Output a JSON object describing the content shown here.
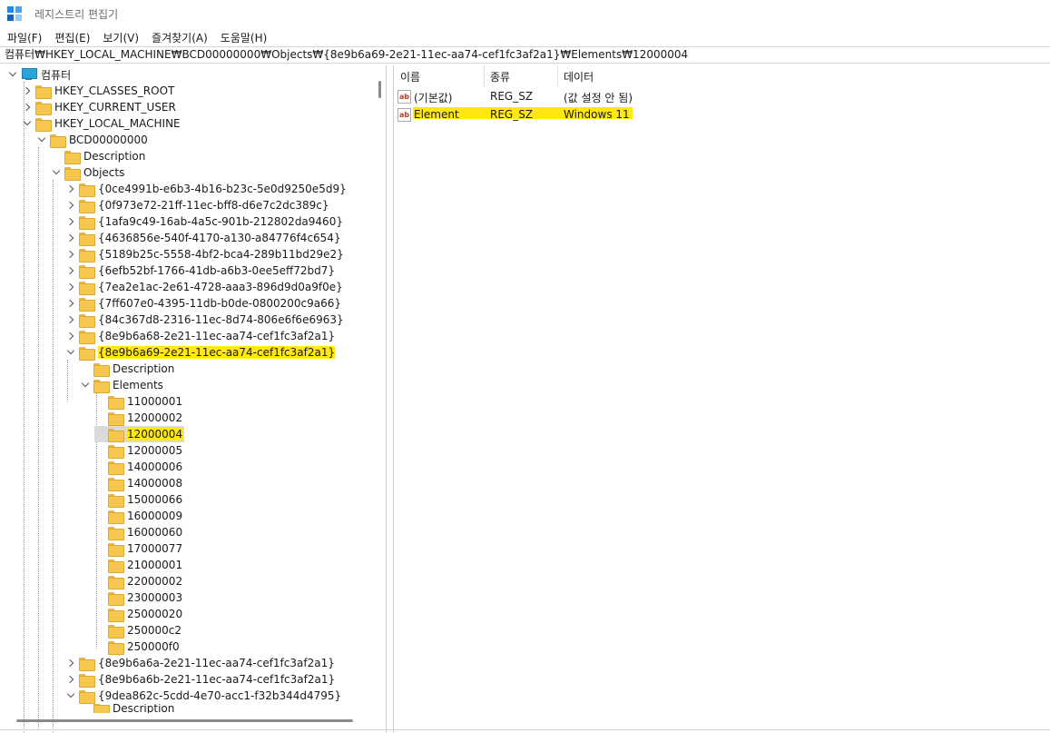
{
  "window": {
    "title": "레지스트리 편집기"
  },
  "menu": [
    "파일(F)",
    "편집(E)",
    "보기(V)",
    "즐겨찾기(A)",
    "도움말(H)"
  ],
  "address": "컴퓨터₩HKEY_LOCAL_MACHINE₩BCD00000000₩Objects₩{8e9b6a69-2e21-11ec-aa74-cef1fc3af2a1}₩Elements₩12000004",
  "tree": {
    "root": "컴퓨터",
    "hives": [
      "HKEY_CLASSES_ROOT",
      "HKEY_CURRENT_USER",
      "HKEY_LOCAL_MACHINE"
    ],
    "bcd": "BCD00000000",
    "description": "Description",
    "objects": "Objects",
    "guids": [
      "{0ce4991b-e6b3-4b16-b23c-5e0d9250e5d9}",
      "{0f973e72-21ff-11ec-bff8-d6e7c2dc389c}",
      "{1afa9c49-16ab-4a5c-901b-212802da9460}",
      "{4636856e-540f-4170-a130-a84776f4c654}",
      "{5189b25c-5558-4bf2-bca4-289b11bd29e2}",
      "{6efb52bf-1766-41db-a6b3-0ee5eff72bd7}",
      "{7ea2e1ac-2e61-4728-aaa3-896d9d0a9f0e}",
      "{7ff607e0-4395-11db-b0de-0800200c9a66}",
      "{84c367d8-2316-11ec-8d74-806e6f6e6963}",
      "{8e9b6a68-2e21-11ec-aa74-cef1fc3af2a1}",
      "{8e9b6a69-2e21-11ec-aa74-cef1fc3af2a1}"
    ],
    "sub_description": "Description",
    "elements": "Elements",
    "element_keys": [
      "11000001",
      "12000002",
      "12000004",
      "12000005",
      "14000006",
      "14000008",
      "15000066",
      "16000009",
      "16000060",
      "17000077",
      "21000001",
      "22000002",
      "23000003",
      "25000020",
      "250000c2",
      "250000f0"
    ],
    "guids_after": [
      "{8e9b6a6a-2e21-11ec-aa74-cef1fc3af2a1}",
      "{8e9b6a6b-2e21-11ec-aa74-cef1fc3af2a1}",
      "{9dea862c-5cdd-4e70-acc1-f32b344d4795}"
    ],
    "last_description": "Description"
  },
  "list": {
    "headers": {
      "name": "이름",
      "type": "종류",
      "data": "데이터"
    },
    "rows": [
      {
        "icon": "ab-icon",
        "name": "(기본값)",
        "type": "REG_SZ",
        "data": "(값 설정 안 됨)"
      },
      {
        "icon": "ab-icon",
        "name": "Element",
        "type": "REG_SZ",
        "data": "Windows 11"
      }
    ]
  },
  "colors": {
    "highlight": "#ffe812",
    "folder": "#f5c74e"
  }
}
